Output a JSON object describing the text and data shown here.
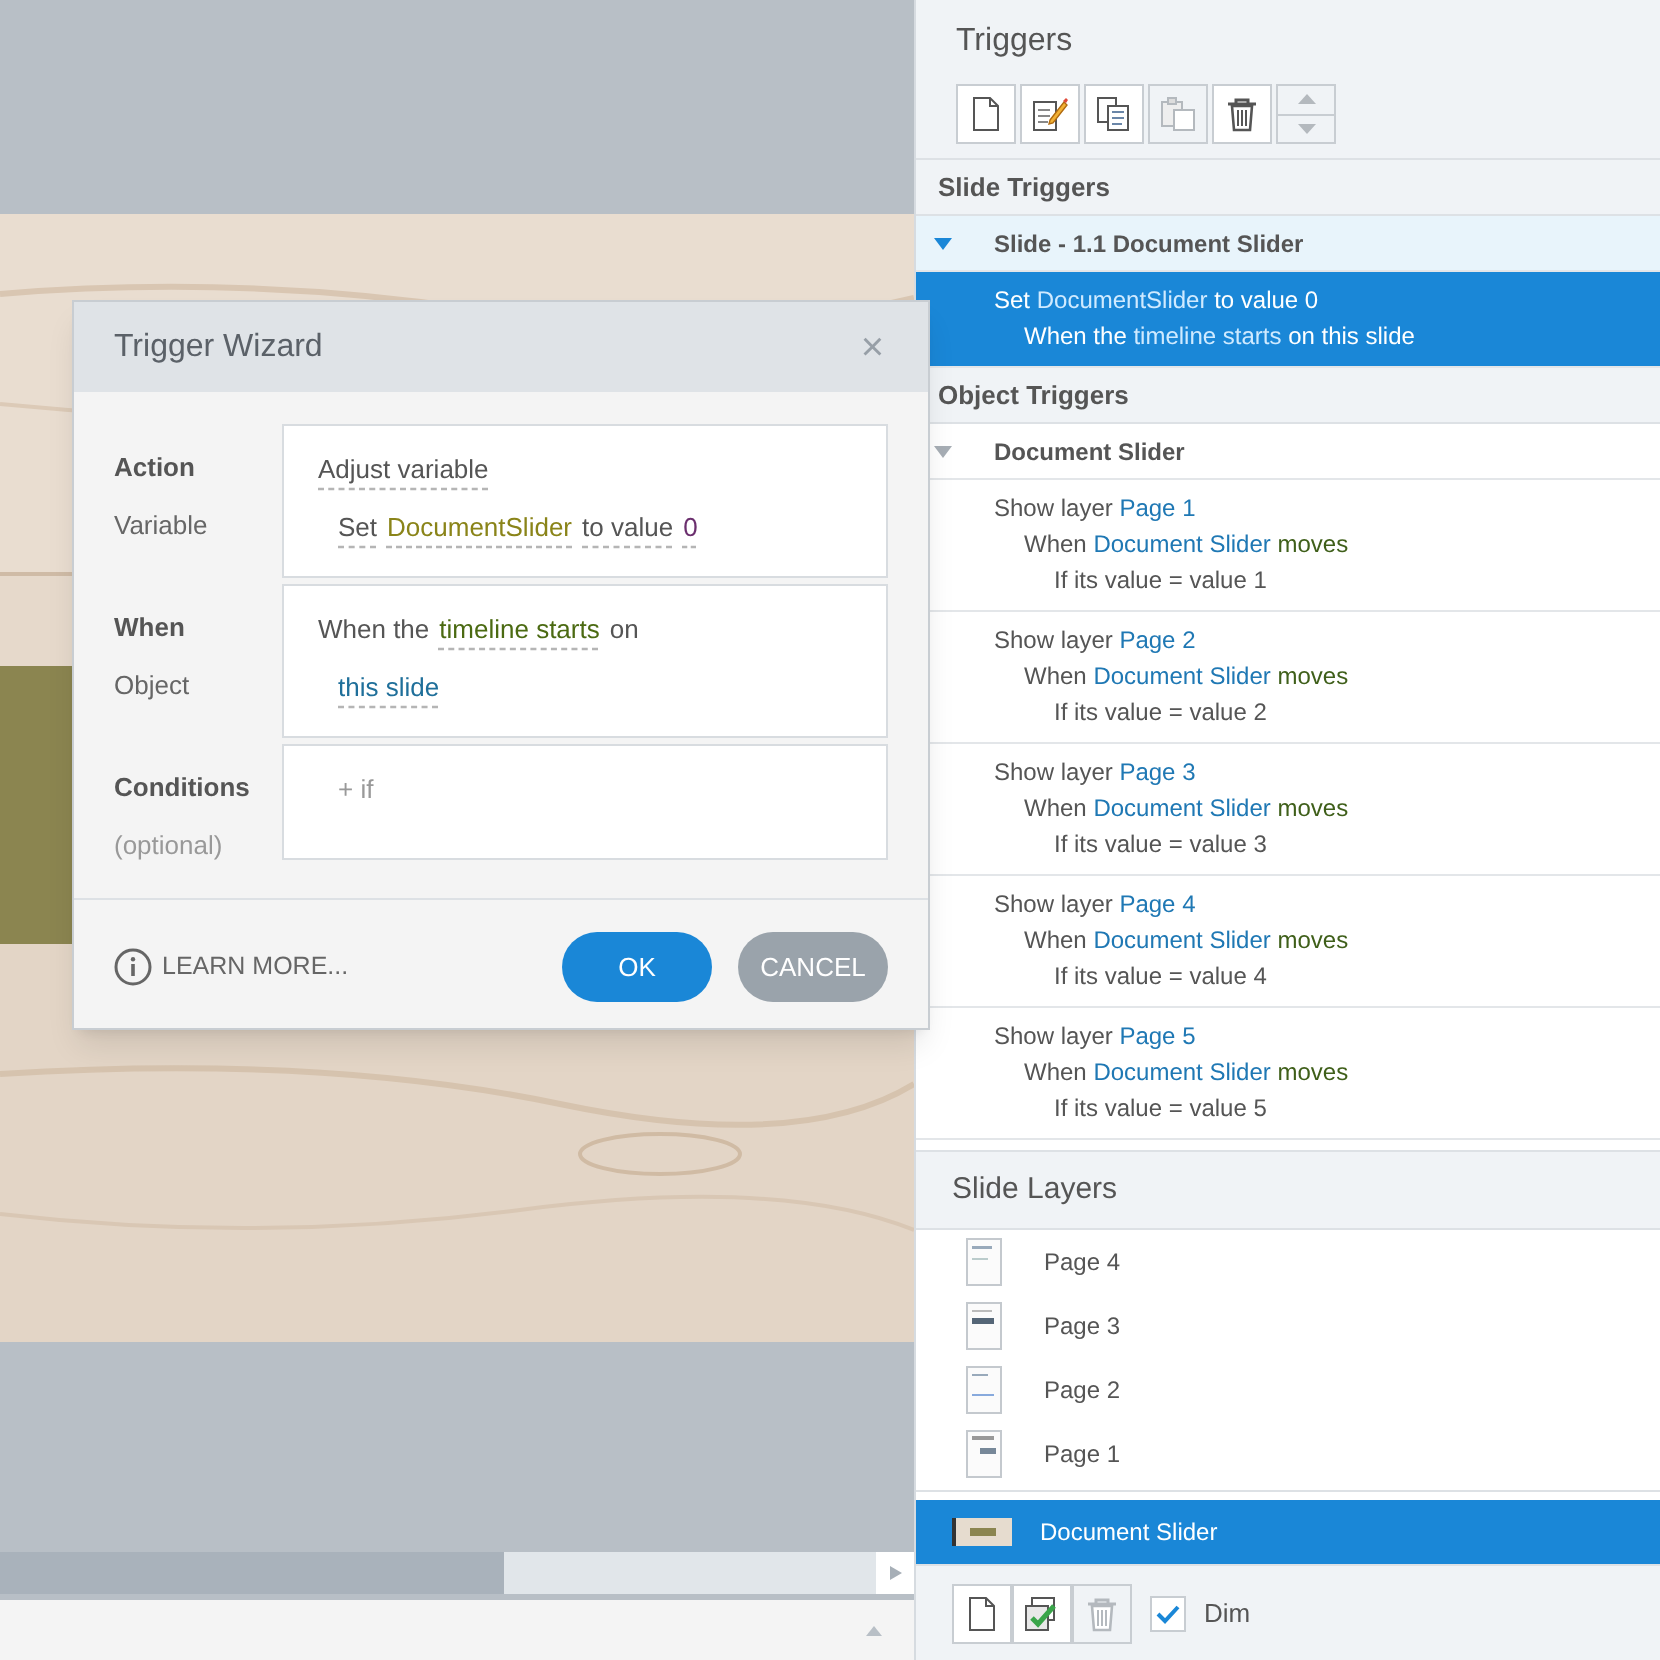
{
  "dialog": {
    "title": "Trigger Wizard",
    "close": "×",
    "rows": [
      {
        "label": "Action",
        "sublabel": "Variable",
        "lines": [
          [
            {
              "text": "Adjust variable",
              "kind": "choice"
            }
          ],
          [
            {
              "text": "Set",
              "kind": "choice"
            },
            {
              "text": "DocumentSlider",
              "kind": "variable"
            },
            {
              "text": "to value",
              "kind": "choice"
            },
            {
              "text": "0",
              "kind": "number"
            }
          ]
        ]
      },
      {
        "label": "When",
        "sublabel": "Object",
        "lines": [
          [
            {
              "text": "When the",
              "kind": "text"
            },
            {
              "text": "timeline starts",
              "kind": "event"
            },
            {
              "text": "on",
              "kind": "text"
            }
          ],
          [
            {
              "text": "this slide",
              "kind": "object"
            }
          ]
        ]
      },
      {
        "label": "Conditions",
        "sublabel": "(optional)",
        "lines": [
          [
            {
              "text": "+ if",
              "kind": "add"
            }
          ]
        ]
      }
    ],
    "learn_more": "LEARN MORE...",
    "ok": "OK",
    "cancel": "CANCEL"
  },
  "triggers_panel": {
    "title": "Triggers",
    "toolbar": [
      {
        "kind": "new",
        "disabled": false
      },
      {
        "kind": "edit",
        "disabled": false
      },
      {
        "kind": "copy",
        "disabled": false
      },
      {
        "kind": "paste",
        "disabled": true
      },
      {
        "kind": "delete",
        "disabled": false
      },
      {
        "kind": "move",
        "disabled": true
      }
    ],
    "sections": [
      {
        "heading": "Slide Triggers",
        "groups": [
          {
            "title": "Slide - 1.1 Document Slider",
            "expanded": true,
            "highlighted": true,
            "triggers": [
              {
                "selected": true,
                "lines": [
                  [
                    {
                      "text": "Set ",
                      "kind": "plain"
                    },
                    {
                      "text": "DocumentSlider",
                      "kind": "link"
                    },
                    {
                      "text": " to value 0",
                      "kind": "plain"
                    }
                  ],
                  [
                    {
                      "text": "When the ",
                      "kind": "plain"
                    },
                    {
                      "text": "timeline starts",
                      "kind": "link"
                    },
                    {
                      "text": " on this slide",
                      "kind": "plain"
                    }
                  ]
                ]
              }
            ]
          }
        ]
      },
      {
        "heading": "Object Triggers",
        "groups": [
          {
            "title": "Document Slider",
            "expanded": true,
            "highlighted": false,
            "triggers": [
              {
                "selected": false,
                "lines": [
                  [
                    {
                      "text": "Show layer ",
                      "kind": "plain"
                    },
                    {
                      "text": "Page 1",
                      "kind": "link"
                    }
                  ],
                  [
                    {
                      "text": "When ",
                      "kind": "plain"
                    },
                    {
                      "text": "Document Slider",
                      "kind": "link"
                    },
                    {
                      "text": " moves",
                      "kind": "event"
                    }
                  ],
                  [
                    {
                      "text": "If its value = value 1",
                      "kind": "plain"
                    }
                  ]
                ]
              },
              {
                "selected": false,
                "lines": [
                  [
                    {
                      "text": "Show layer ",
                      "kind": "plain"
                    },
                    {
                      "text": "Page 2",
                      "kind": "link"
                    }
                  ],
                  [
                    {
                      "text": "When ",
                      "kind": "plain"
                    },
                    {
                      "text": "Document Slider",
                      "kind": "link"
                    },
                    {
                      "text": " moves",
                      "kind": "event"
                    }
                  ],
                  [
                    {
                      "text": "If its value = value 2",
                      "kind": "plain"
                    }
                  ]
                ]
              },
              {
                "selected": false,
                "lines": [
                  [
                    {
                      "text": "Show layer ",
                      "kind": "plain"
                    },
                    {
                      "text": "Page 3",
                      "kind": "link"
                    }
                  ],
                  [
                    {
                      "text": "When ",
                      "kind": "plain"
                    },
                    {
                      "text": "Document Slider",
                      "kind": "link"
                    },
                    {
                      "text": " moves",
                      "kind": "event"
                    }
                  ],
                  [
                    {
                      "text": "If its value = value 3",
                      "kind": "plain"
                    }
                  ]
                ]
              },
              {
                "selected": false,
                "lines": [
                  [
                    {
                      "text": "Show layer ",
                      "kind": "plain"
                    },
                    {
                      "text": "Page 4",
                      "kind": "link"
                    }
                  ],
                  [
                    {
                      "text": "When ",
                      "kind": "plain"
                    },
                    {
                      "text": "Document Slider",
                      "kind": "link"
                    },
                    {
                      "text": " moves",
                      "kind": "event"
                    }
                  ],
                  [
                    {
                      "text": "If its value = value 4",
                      "kind": "plain"
                    }
                  ]
                ]
              },
              {
                "selected": false,
                "lines": [
                  [
                    {
                      "text": "Show layer ",
                      "kind": "plain"
                    },
                    {
                      "text": "Page 5",
                      "kind": "link"
                    }
                  ],
                  [
                    {
                      "text": "When ",
                      "kind": "plain"
                    },
                    {
                      "text": "Document Slider",
                      "kind": "link"
                    },
                    {
                      "text": " moves",
                      "kind": "event"
                    }
                  ],
                  [
                    {
                      "text": "If its value = value 5",
                      "kind": "plain"
                    }
                  ]
                ]
              }
            ]
          }
        ]
      }
    ]
  },
  "layers_panel": {
    "title": "Slide Layers",
    "layers": [
      {
        "label": "Page 4",
        "selected": false
      },
      {
        "label": "Page 3",
        "selected": false
      },
      {
        "label": "Page 2",
        "selected": false
      },
      {
        "label": "Page 1",
        "selected": false
      }
    ],
    "base_layer": {
      "label": "Document Slider",
      "selected": true
    },
    "toolbar": [
      {
        "kind": "new",
        "disabled": false
      },
      {
        "kind": "duplicate",
        "disabled": false
      },
      {
        "kind": "delete",
        "disabled": true
      }
    ],
    "dim": {
      "label": "Dim",
      "checked": true
    }
  }
}
